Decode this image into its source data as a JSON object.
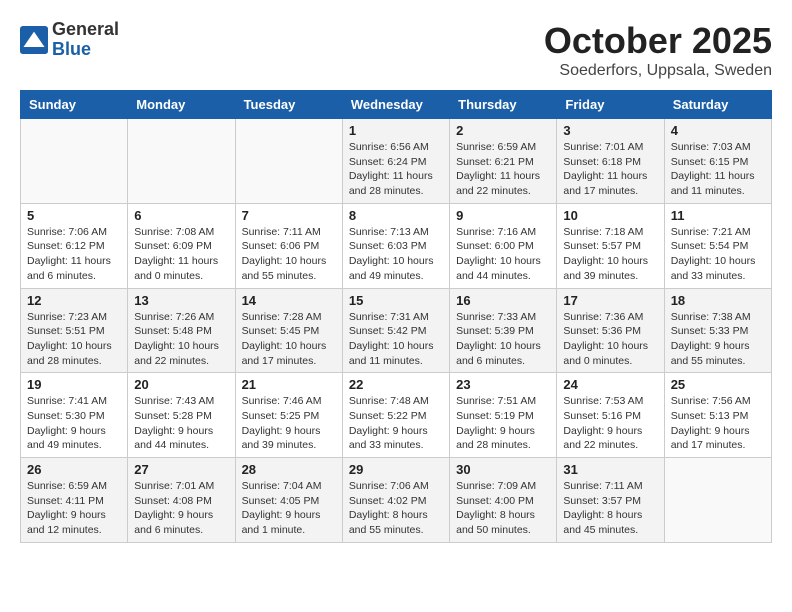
{
  "header": {
    "logo_general": "General",
    "logo_blue": "Blue",
    "month": "October 2025",
    "location": "Soederfors, Uppsala, Sweden"
  },
  "weekdays": [
    "Sunday",
    "Monday",
    "Tuesday",
    "Wednesday",
    "Thursday",
    "Friday",
    "Saturday"
  ],
  "weeks": [
    [
      {
        "day": "",
        "info": ""
      },
      {
        "day": "",
        "info": ""
      },
      {
        "day": "",
        "info": ""
      },
      {
        "day": "1",
        "info": "Sunrise: 6:56 AM\nSunset: 6:24 PM\nDaylight: 11 hours\nand 28 minutes."
      },
      {
        "day": "2",
        "info": "Sunrise: 6:59 AM\nSunset: 6:21 PM\nDaylight: 11 hours\nand 22 minutes."
      },
      {
        "day": "3",
        "info": "Sunrise: 7:01 AM\nSunset: 6:18 PM\nDaylight: 11 hours\nand 17 minutes."
      },
      {
        "day": "4",
        "info": "Sunrise: 7:03 AM\nSunset: 6:15 PM\nDaylight: 11 hours\nand 11 minutes."
      }
    ],
    [
      {
        "day": "5",
        "info": "Sunrise: 7:06 AM\nSunset: 6:12 PM\nDaylight: 11 hours\nand 6 minutes."
      },
      {
        "day": "6",
        "info": "Sunrise: 7:08 AM\nSunset: 6:09 PM\nDaylight: 11 hours\nand 0 minutes."
      },
      {
        "day": "7",
        "info": "Sunrise: 7:11 AM\nSunset: 6:06 PM\nDaylight: 10 hours\nand 55 minutes."
      },
      {
        "day": "8",
        "info": "Sunrise: 7:13 AM\nSunset: 6:03 PM\nDaylight: 10 hours\nand 49 minutes."
      },
      {
        "day": "9",
        "info": "Sunrise: 7:16 AM\nSunset: 6:00 PM\nDaylight: 10 hours\nand 44 minutes."
      },
      {
        "day": "10",
        "info": "Sunrise: 7:18 AM\nSunset: 5:57 PM\nDaylight: 10 hours\nand 39 minutes."
      },
      {
        "day": "11",
        "info": "Sunrise: 7:21 AM\nSunset: 5:54 PM\nDaylight: 10 hours\nand 33 minutes."
      }
    ],
    [
      {
        "day": "12",
        "info": "Sunrise: 7:23 AM\nSunset: 5:51 PM\nDaylight: 10 hours\nand 28 minutes."
      },
      {
        "day": "13",
        "info": "Sunrise: 7:26 AM\nSunset: 5:48 PM\nDaylight: 10 hours\nand 22 minutes."
      },
      {
        "day": "14",
        "info": "Sunrise: 7:28 AM\nSunset: 5:45 PM\nDaylight: 10 hours\nand 17 minutes."
      },
      {
        "day": "15",
        "info": "Sunrise: 7:31 AM\nSunset: 5:42 PM\nDaylight: 10 hours\nand 11 minutes."
      },
      {
        "day": "16",
        "info": "Sunrise: 7:33 AM\nSunset: 5:39 PM\nDaylight: 10 hours\nand 6 minutes."
      },
      {
        "day": "17",
        "info": "Sunrise: 7:36 AM\nSunset: 5:36 PM\nDaylight: 10 hours\nand 0 minutes."
      },
      {
        "day": "18",
        "info": "Sunrise: 7:38 AM\nSunset: 5:33 PM\nDaylight: 9 hours\nand 55 minutes."
      }
    ],
    [
      {
        "day": "19",
        "info": "Sunrise: 7:41 AM\nSunset: 5:30 PM\nDaylight: 9 hours\nand 49 minutes."
      },
      {
        "day": "20",
        "info": "Sunrise: 7:43 AM\nSunset: 5:28 PM\nDaylight: 9 hours\nand 44 minutes."
      },
      {
        "day": "21",
        "info": "Sunrise: 7:46 AM\nSunset: 5:25 PM\nDaylight: 9 hours\nand 39 minutes."
      },
      {
        "day": "22",
        "info": "Sunrise: 7:48 AM\nSunset: 5:22 PM\nDaylight: 9 hours\nand 33 minutes."
      },
      {
        "day": "23",
        "info": "Sunrise: 7:51 AM\nSunset: 5:19 PM\nDaylight: 9 hours\nand 28 minutes."
      },
      {
        "day": "24",
        "info": "Sunrise: 7:53 AM\nSunset: 5:16 PM\nDaylight: 9 hours\nand 22 minutes."
      },
      {
        "day": "25",
        "info": "Sunrise: 7:56 AM\nSunset: 5:13 PM\nDaylight: 9 hours\nand 17 minutes."
      }
    ],
    [
      {
        "day": "26",
        "info": "Sunrise: 6:59 AM\nSunset: 4:11 PM\nDaylight: 9 hours\nand 12 minutes."
      },
      {
        "day": "27",
        "info": "Sunrise: 7:01 AM\nSunset: 4:08 PM\nDaylight: 9 hours\nand 6 minutes."
      },
      {
        "day": "28",
        "info": "Sunrise: 7:04 AM\nSunset: 4:05 PM\nDaylight: 9 hours\nand 1 minute."
      },
      {
        "day": "29",
        "info": "Sunrise: 7:06 AM\nSunset: 4:02 PM\nDaylight: 8 hours\nand 55 minutes."
      },
      {
        "day": "30",
        "info": "Sunrise: 7:09 AM\nSunset: 4:00 PM\nDaylight: 8 hours\nand 50 minutes."
      },
      {
        "day": "31",
        "info": "Sunrise: 7:11 AM\nSunset: 3:57 PM\nDaylight: 8 hours\nand 45 minutes."
      },
      {
        "day": "",
        "info": ""
      }
    ]
  ]
}
